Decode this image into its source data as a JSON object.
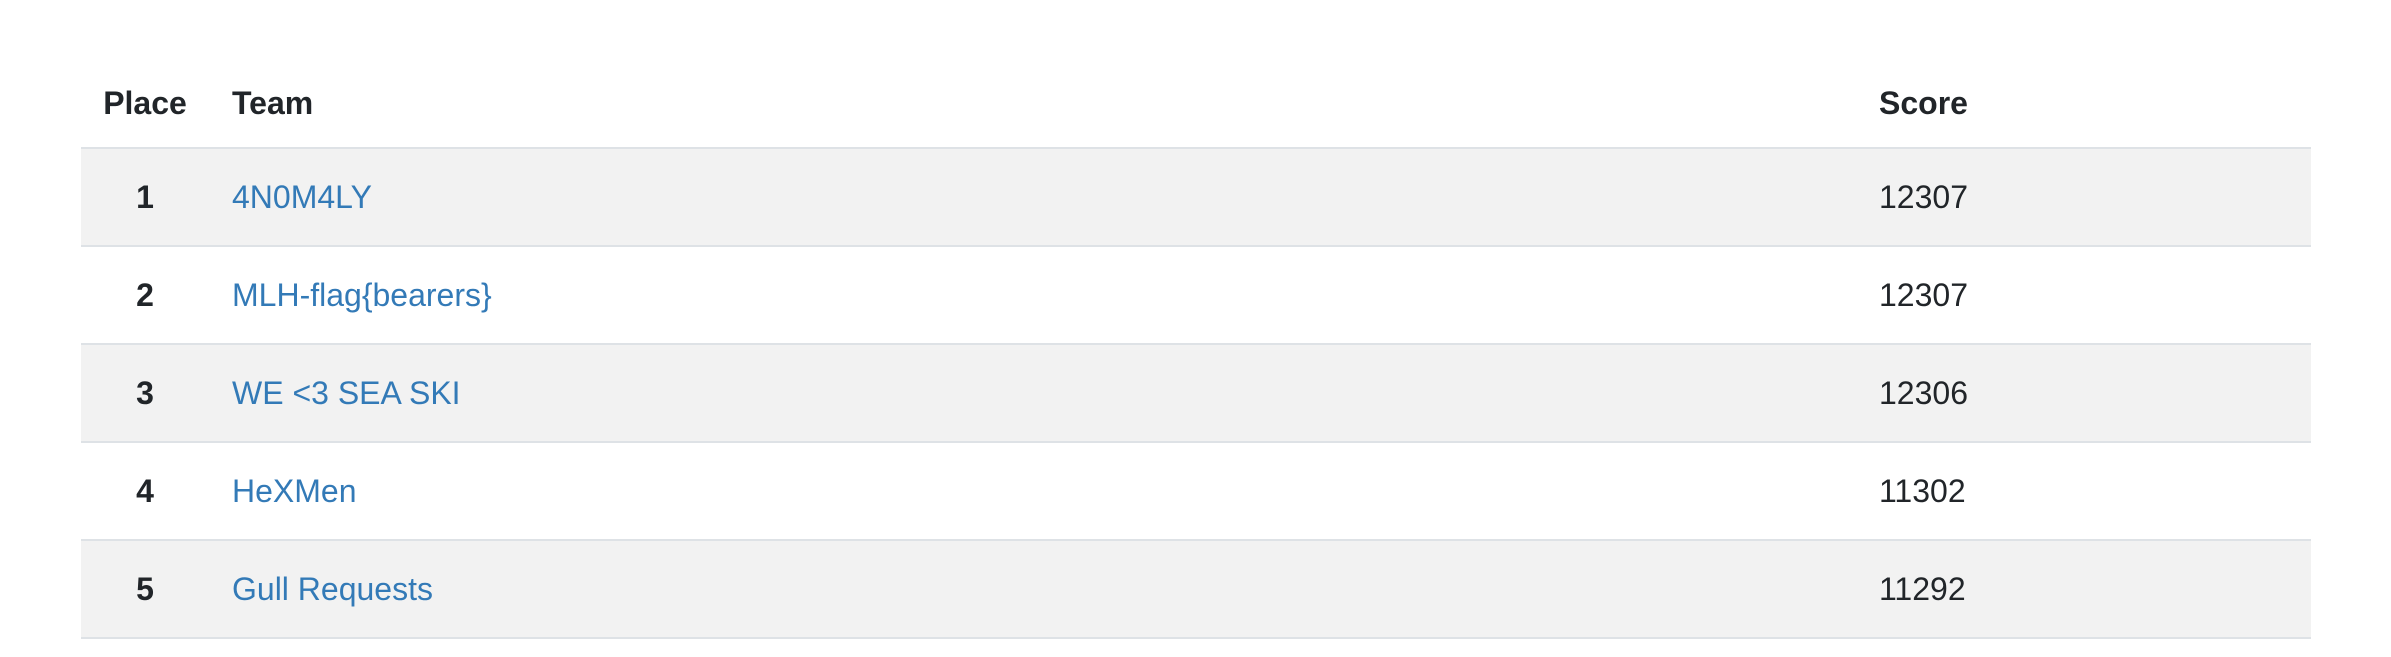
{
  "table": {
    "headers": {
      "place": "Place",
      "team": "Team",
      "score": "Score"
    },
    "rows": [
      {
        "place": "1",
        "team": "4N0M4LY",
        "score": "12307"
      },
      {
        "place": "2",
        "team": "MLH-flag{bearers}",
        "score": "12307"
      },
      {
        "place": "3",
        "team": "WE <3 SEA SKI",
        "score": "12306"
      },
      {
        "place": "4",
        "team": "HeXMen",
        "score": "11302"
      },
      {
        "place": "5",
        "team": "Gull Requests",
        "score": "11292"
      }
    ]
  },
  "colors": {
    "link": "#337ab7",
    "stripe": "#f2f2f2",
    "border": "#dee2e6",
    "text": "#212529"
  }
}
